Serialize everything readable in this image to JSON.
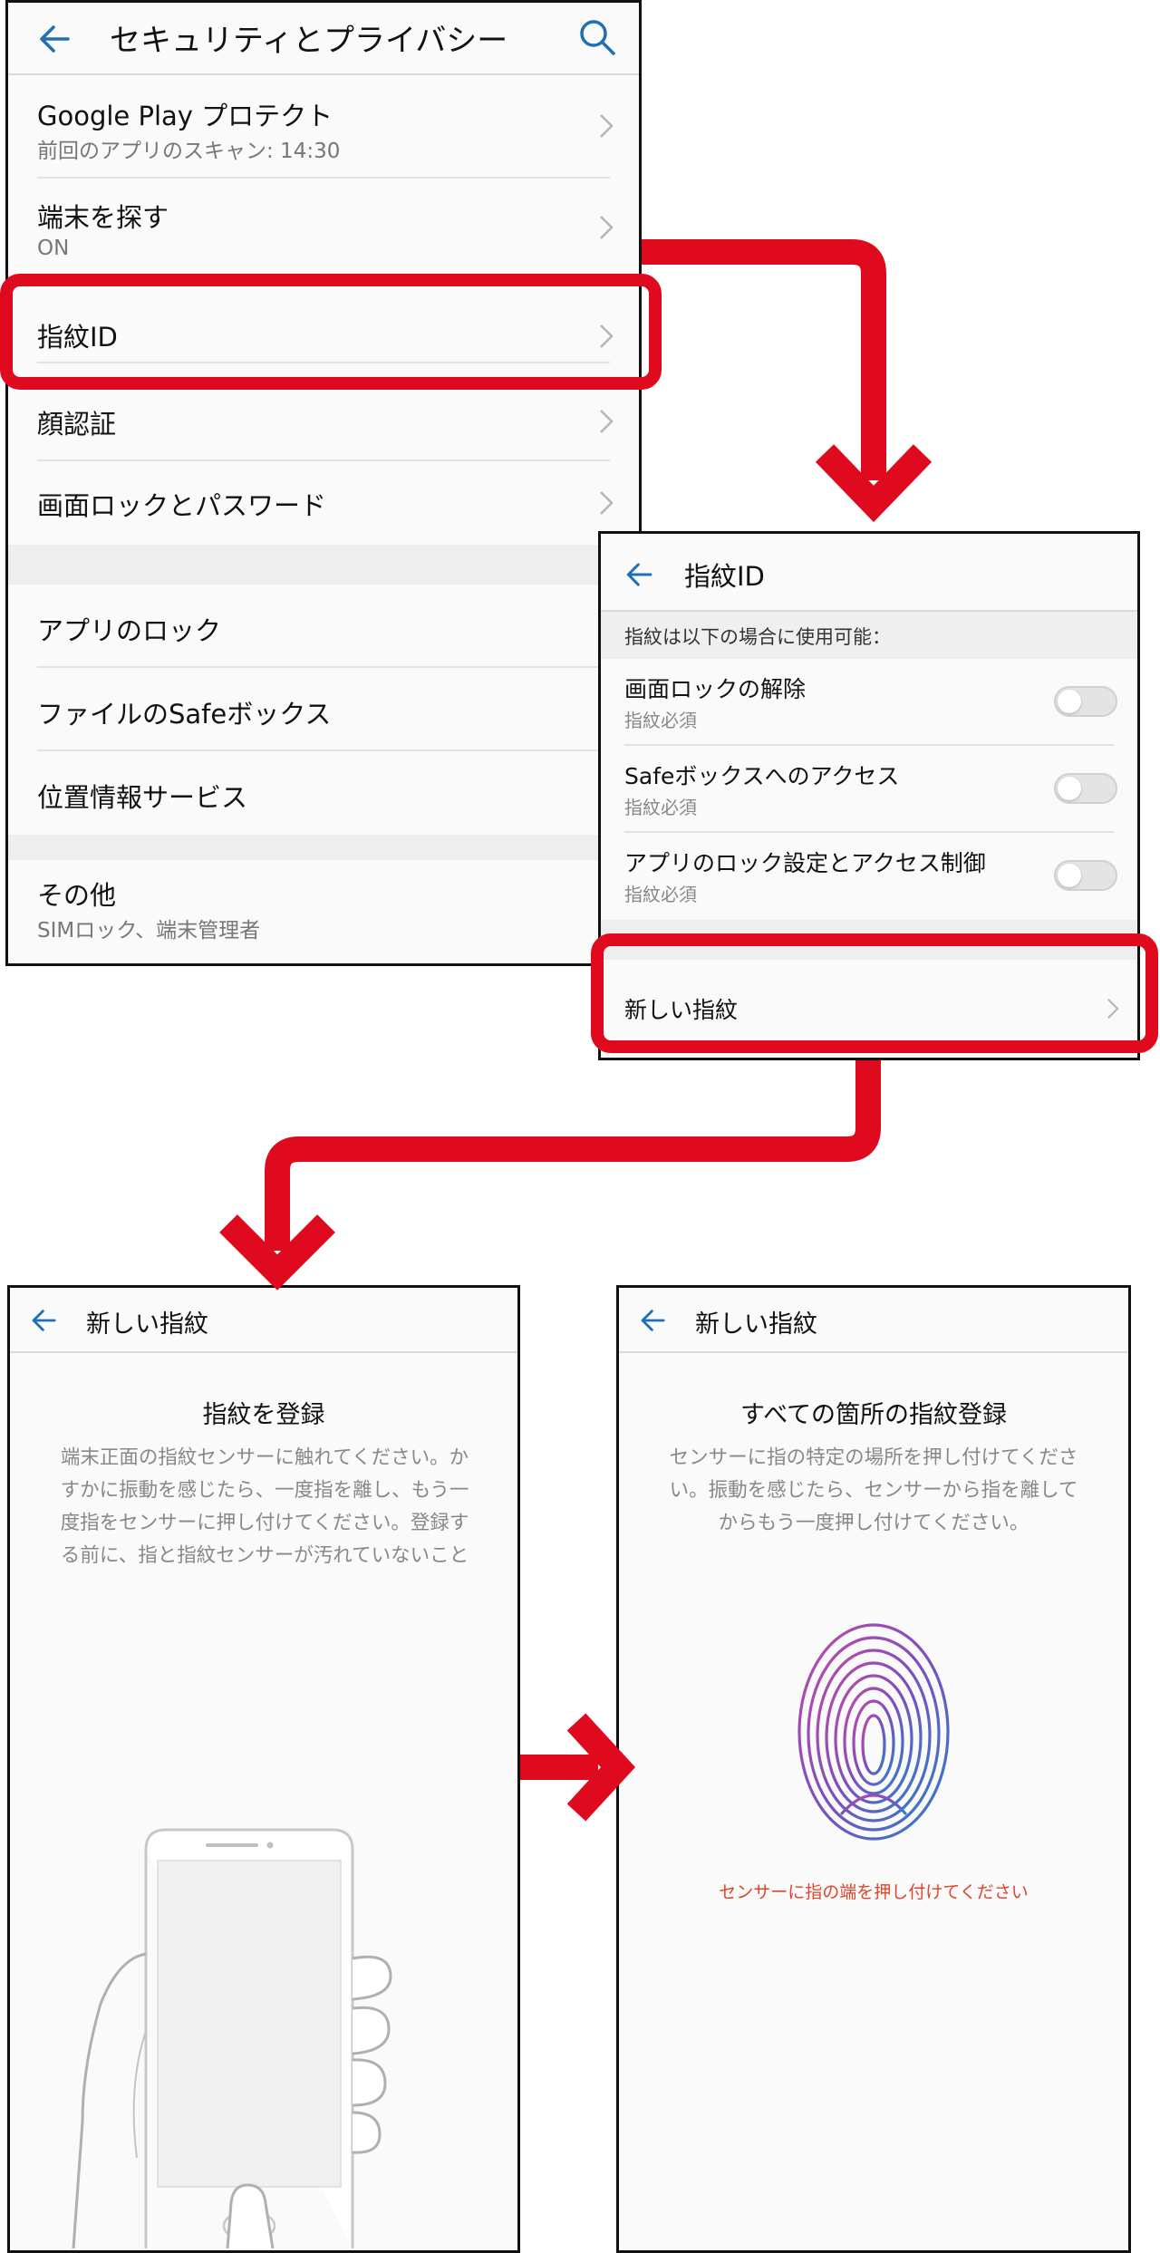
{
  "colors": {
    "highlight": "#e00a1e",
    "accent_blue": "#1f6fb2",
    "hint_orange": "#e0452b"
  },
  "screen1": {
    "title": "セキュリティとプライバシー",
    "back_icon": "arrow-left-icon",
    "search_icon": "search-icon",
    "items": [
      {
        "label": "Google Play プロテクト",
        "sub": "前回のアプリのスキャン: 14:30"
      },
      {
        "label": "端末を探す",
        "sub": "ON"
      },
      {
        "label": "指紋ID"
      },
      {
        "label": "顔認証"
      },
      {
        "label": "画面ロックとパスワード"
      },
      {
        "label": "アプリのロック"
      },
      {
        "label": "ファイルのSafeボックス"
      },
      {
        "label": "位置情報サービス"
      },
      {
        "label": "その他",
        "sub": "SIMロック、端末管理者"
      }
    ]
  },
  "screen2": {
    "title": "指紋ID",
    "section_header": "指紋は以下の場合に使用可能：",
    "items": [
      {
        "label": "画面ロックの解除",
        "sub": "指紋必須",
        "toggle": "off"
      },
      {
        "label": "Safeボックスへのアクセス",
        "sub": "指紋必須",
        "toggle": "off"
      },
      {
        "label": "アプリのロック設定とアクセス制御",
        "sub": "指紋必須",
        "toggle": "off"
      }
    ],
    "new_fingerprint": "新しい指紋"
  },
  "screen3": {
    "title": "新しい指紋",
    "heading": "指紋を登録",
    "description": [
      "端末正面の指紋センサーに触れてください。か",
      "すかに振動を感じたら、一度指を離し、もう一",
      "度指をセンサーに押し付けてください。登録す",
      "る前に、指と指紋センサーが汚れていないこと"
    ]
  },
  "screen4": {
    "title": "新しい指紋",
    "heading": "すべての箇所の指紋登録",
    "description": [
      "センサーに指の特定の場所を押し付けてくださ",
      "い。振動を感じたら、センサーから指を離して",
      "からもう一度押し付けてください。"
    ],
    "hint": "センサーに指の端を押し付けてください"
  }
}
